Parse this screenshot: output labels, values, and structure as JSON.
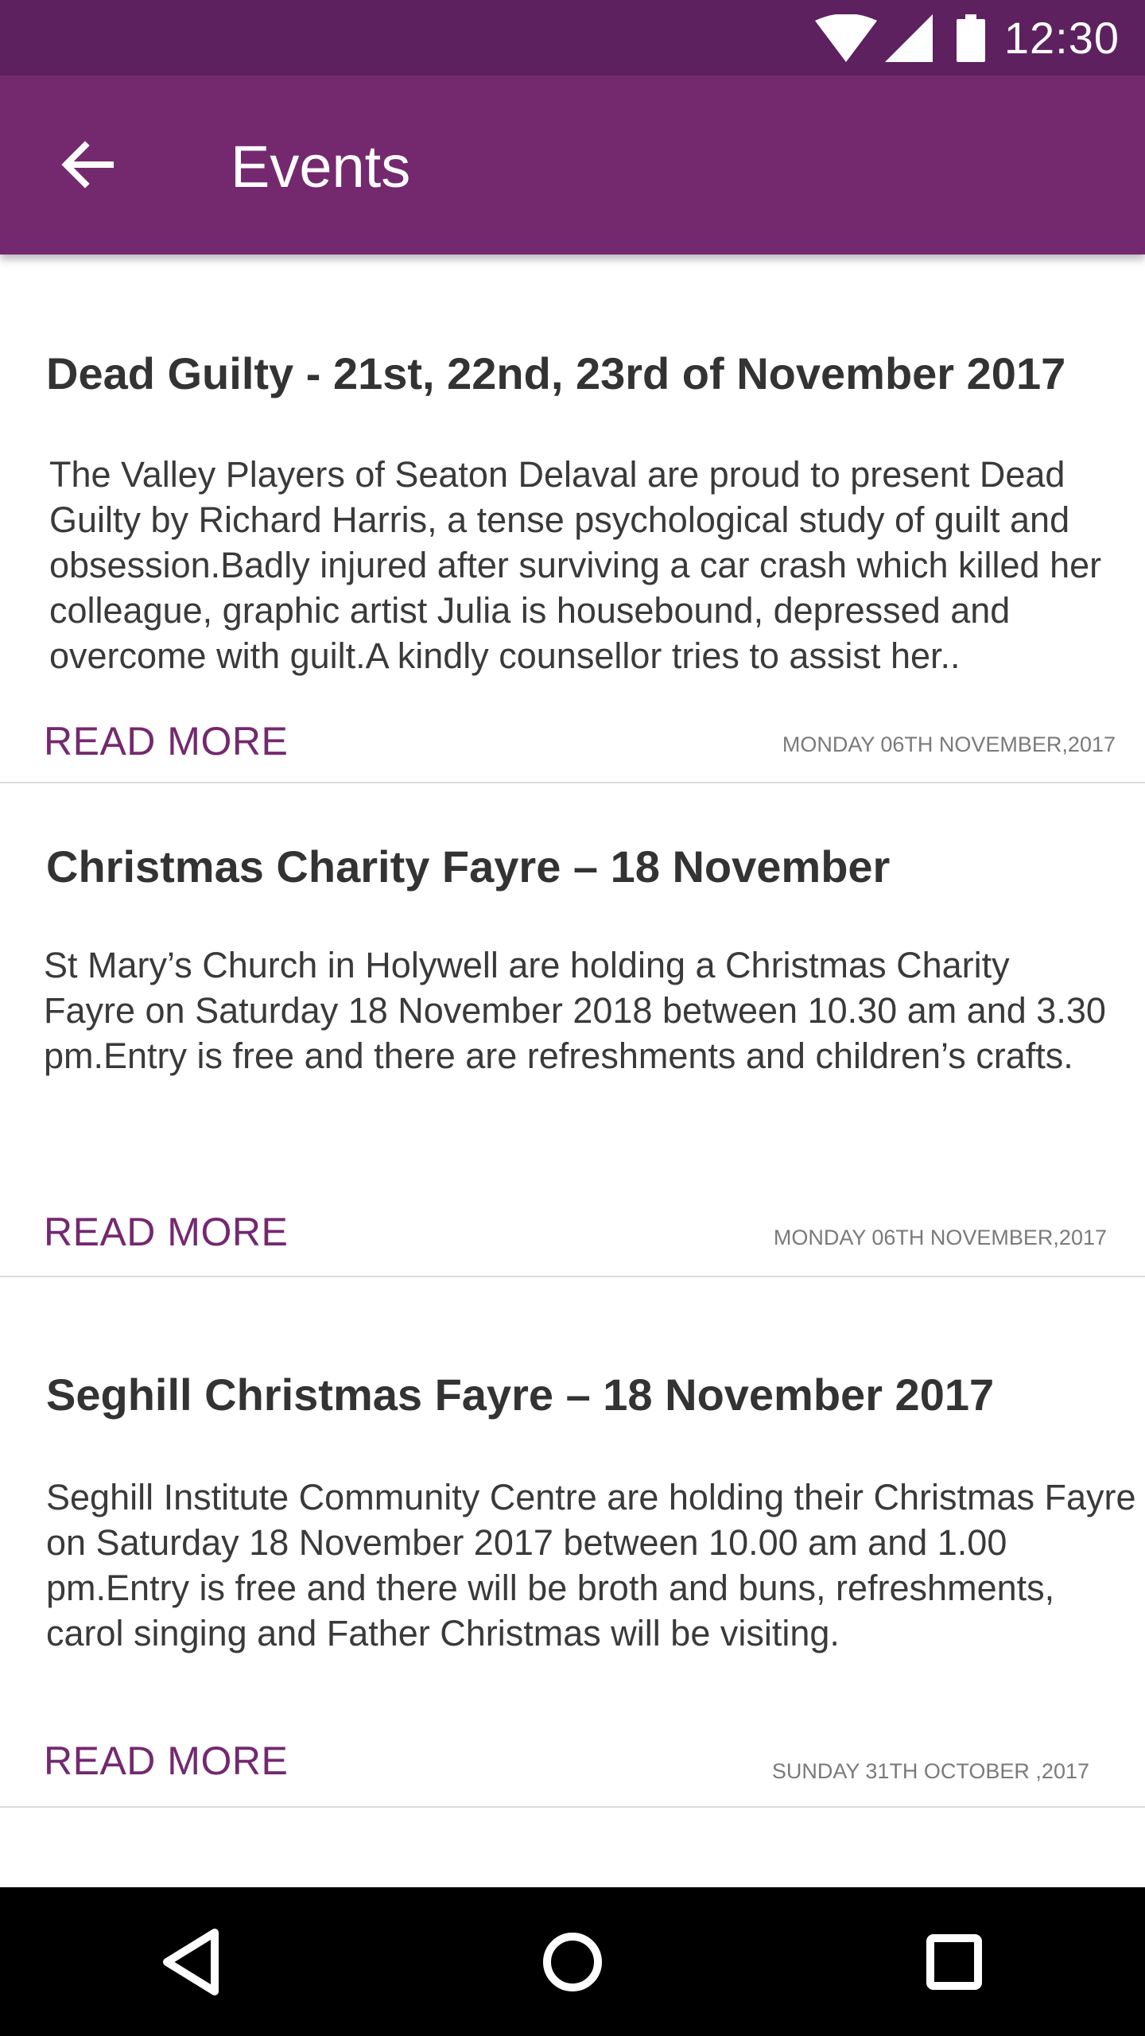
{
  "status_bar": {
    "time": "12:30",
    "icons": [
      "wifi-icon",
      "signal-icon",
      "battery-icon"
    ]
  },
  "app_bar": {
    "title": "Events",
    "back_icon": "arrow-left-icon"
  },
  "events": [
    {
      "title": "Dead Guilty - 21st,  22nd, 23rd of November 2017",
      "description": "The Valley Players of Seaton Delaval are proud to present Dead Guilty by Richard Harris, a tense psychological study of guilt and obsession.Badly injured after surviving a car crash which killed her colleague, graphic artist Julia is housebound, depressed and overcome with guilt.A kindly counsellor tries to assist her..",
      "read_more": "READ MORE",
      "date": "MONDAY 06TH NOVEMBER,2017"
    },
    {
      "title": "Christmas Charity Fayre – 18 November",
      "description": "St Mary’s Church in Holywell are holding a Christmas Charity Fayre on Saturday 18 November 2018 between 10.30 am and 3.30 pm.Entry is free and there are refreshments and children’s crafts.",
      "read_more": "READ MORE",
      "date": "MONDAY 06TH NOVEMBER,2017"
    },
    {
      "title": "Seghill Christmas Fayre – 18 November 2017",
      "description": "Seghill Institute Community Centre are holding their Christmas Fayre on Saturday 18 November 2017 between 10.00 am and 1.00 pm.Entry is free and there will be broth and buns, refreshments, carol singing and Father Christmas will be visiting.",
      "read_more": "READ MORE",
      "date": "SUNDAY 31TH OCTOBER ,2017"
    }
  ],
  "nav_bar": {
    "buttons": [
      "back-triangle-icon",
      "home-circle-icon",
      "recents-square-icon"
    ]
  },
  "colors": {
    "primary": "#74296f",
    "primary_dark": "#5d2160",
    "divider": "#dddddd"
  }
}
